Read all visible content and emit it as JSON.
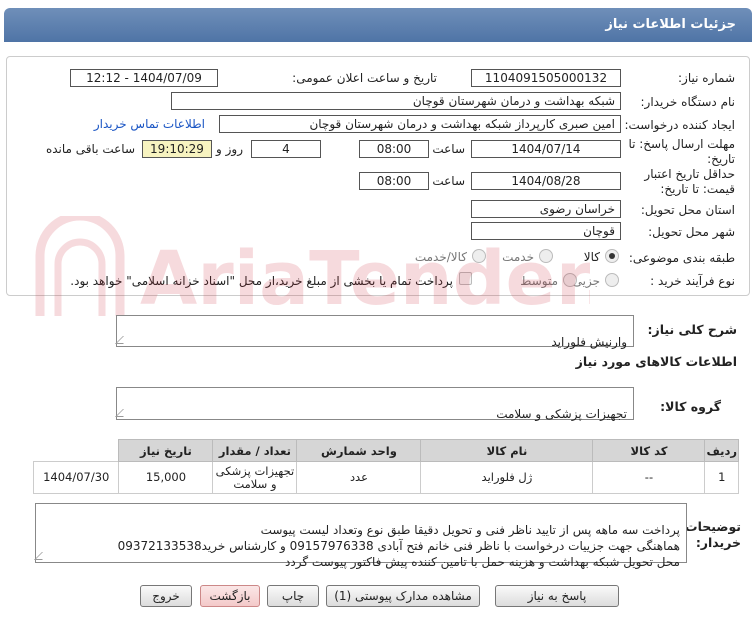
{
  "header": {
    "title": "جزئیات اطلاعات نیاز"
  },
  "need": {
    "number_label": "شماره نیاز:",
    "number": "1104091505000132",
    "announce_label": "تاریخ و ساعت اعلان عمومی:",
    "announce_value": "1404/07/09 - 12:12",
    "buyer_label": "نام دستگاه خریدار:",
    "buyer": "شبکه بهداشت و درمان شهرستان قوچان",
    "creator_label": "ایجاد کننده درخواست:",
    "creator": "امین صبری کارپرداز شبکه بهداشت و درمان شهرستان قوچان",
    "contact_link": "اطلاعات تماس خریدار",
    "deadline_label_1": "مهلت ارسال پاسخ: تا",
    "deadline_label_2": "تاریخ:",
    "deadline_date": "1404/07/14",
    "time_label": "ساعت",
    "deadline_time": "08:00",
    "days": "4",
    "days_label": "روز و",
    "remaining_time": "19:10:29",
    "remaining_label": "ساعت باقی مانده",
    "validity_label_1": "حداقل تاریخ اعتبار",
    "validity_label_2": "قیمت: تا تاریخ:",
    "validity_date": "1404/08/28",
    "validity_time": "08:00",
    "province_label": "استان محل تحویل:",
    "province": "خراسان رضوی",
    "city_label": "شهر محل تحویل:",
    "city": "قوچان",
    "category_label": "طبقه بندی موضوعی:",
    "category_options": [
      "کالا",
      "خدمت",
      "کالا/خدمت"
    ],
    "category_selected": "کالا",
    "process_label": "نوع فرآیند خرید :",
    "process_options": [
      "جزیی",
      "متوسط"
    ],
    "payment_text": "پرداخت تمام یا بخشی از مبلغ خرید،از محل \"اسناد خزانه اسلامی\" خواهد بود."
  },
  "summary": {
    "label": "شرح کلی نیاز:",
    "value": "وارنیش فلوراید"
  },
  "goods_info_title": "اطلاعات کالاهای مورد نیاز",
  "group": {
    "label": "گروه کالا:",
    "value": "تجهیزات پزشکی و سلامت"
  },
  "table": {
    "headers": [
      "ردیف",
      "کد کالا",
      "نام کالا",
      "واحد شمارش",
      "تعداد / مقدار",
      "تاریخ نیاز"
    ],
    "rows": [
      [
        "1",
        "--",
        "ژل فلوراید",
        "عدد",
        "15,000",
        "1404/07/30"
      ]
    ],
    "row_group": "تجهیزات پزشکی و سلامت"
  },
  "notes": {
    "label": "توضیحات خریدار:",
    "value": "پرداخت سه ماهه پس از تایید ناظر فنی و تحویل دقیقا طبق نوع وتعداد لیست پیوست\nهماهنگی جهت جزییات درخواست با ناظر فنی خانم فتح آبادی 09157976338 و کارشناس خرید09372133538\nمحل تحویل شبکه بهداشت و هزینه حمل با تامین کننده پیش فاکتور پیوست گردد"
  },
  "buttons": {
    "reply": "پاسخ به نیاز",
    "attachments": "مشاهده مدارک پیوستی (1)",
    "print": "چاپ",
    "back": "بازگشت",
    "exit": "خروج"
  },
  "watermark": {
    "text": "AriaTender.neT"
  },
  "colors": {
    "header": "#5a7cad",
    "link": "#1a55c4",
    "remaining_bg": "#f7f3c0"
  }
}
